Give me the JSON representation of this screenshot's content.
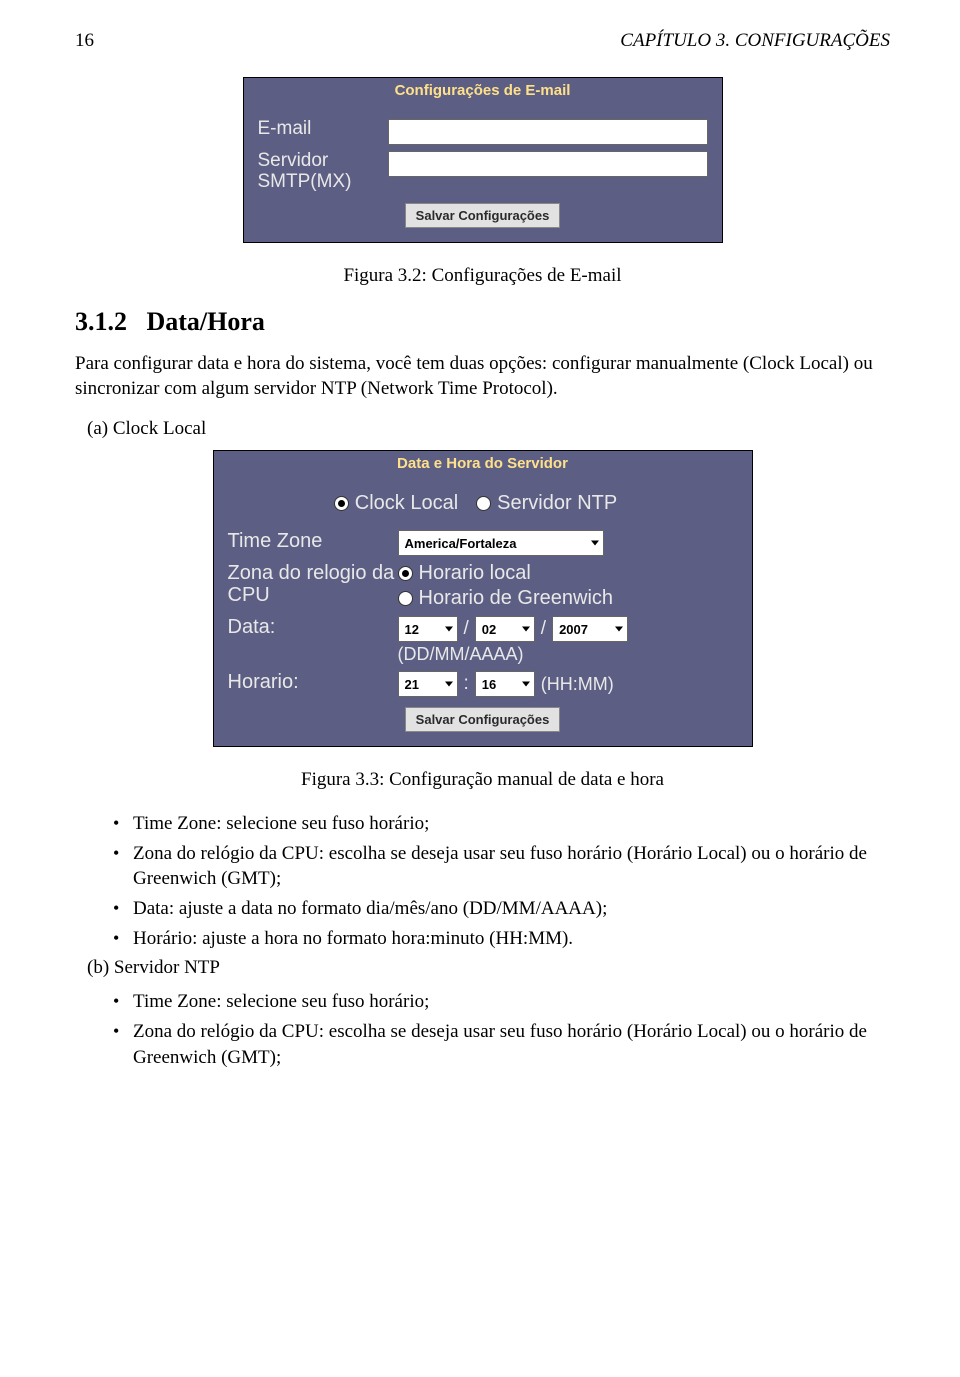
{
  "header": {
    "page_number": "16",
    "chapter_running": "CAPÍTULO 3.  CONFIGURAÇÕES"
  },
  "fig1": {
    "panel_title": "Configurações de E-mail",
    "email_label": "E-mail",
    "smtp_label": "Servidor SMTP(MX)",
    "save_btn": "Salvar Configurações",
    "caption": "Figura 3.2: Configurações de E-mail"
  },
  "section": {
    "num": "3.1.2",
    "title": "Data/Hora",
    "paragraph": "Para configurar data e hora do sistema, você tem duas opções: configurar manualmente (Clock Local) ou sincronizar com algum servidor NTP (Network Time Protocol).",
    "item_a": "(a) Clock Local",
    "item_b": "(b) Servidor NTP"
  },
  "fig2": {
    "panel_title": "Data e Hora do Servidor",
    "radio_local": "Clock Local",
    "radio_ntp": "Servidor NTP",
    "tz_label": "Time Zone",
    "tz_value": "America/Fortaleza",
    "cpu_label": "Zona do relogio da CPU",
    "cpu_radio1": "Horario local",
    "cpu_radio2": "Horario de Greenwich",
    "date_label": "Data:",
    "date_dd": "12",
    "date_mm": "02",
    "date_yyyy": "2007",
    "date_hint": "(DD/MM/AAAA)",
    "time_label": "Horario:",
    "time_hh": "21",
    "time_mm": "16",
    "time_hint": "(HH:MM)",
    "save_btn": "Salvar Configurações",
    "caption": "Figura 3.3: Configuração manual de data e hora"
  },
  "bullets_a": {
    "b1": "Time Zone: selecione seu fuso horário;",
    "b2": "Zona do relógio da CPU: escolha se deseja usar seu fuso horário (Horário Local) ou o horário de Greenwich (GMT);",
    "b3": "Data: ajuste a data no formato dia/mês/ano (DD/MM/AAAA);",
    "b4": "Horário: ajuste a hora no formato hora:minuto (HH:MM)."
  },
  "bullets_b": {
    "b1": "Time Zone: selecione seu fuso horário;",
    "b2": "Zona do relógio da CPU: escolha se deseja usar seu fuso horário (Horário Local) ou o horário de Greenwich (GMT);"
  }
}
